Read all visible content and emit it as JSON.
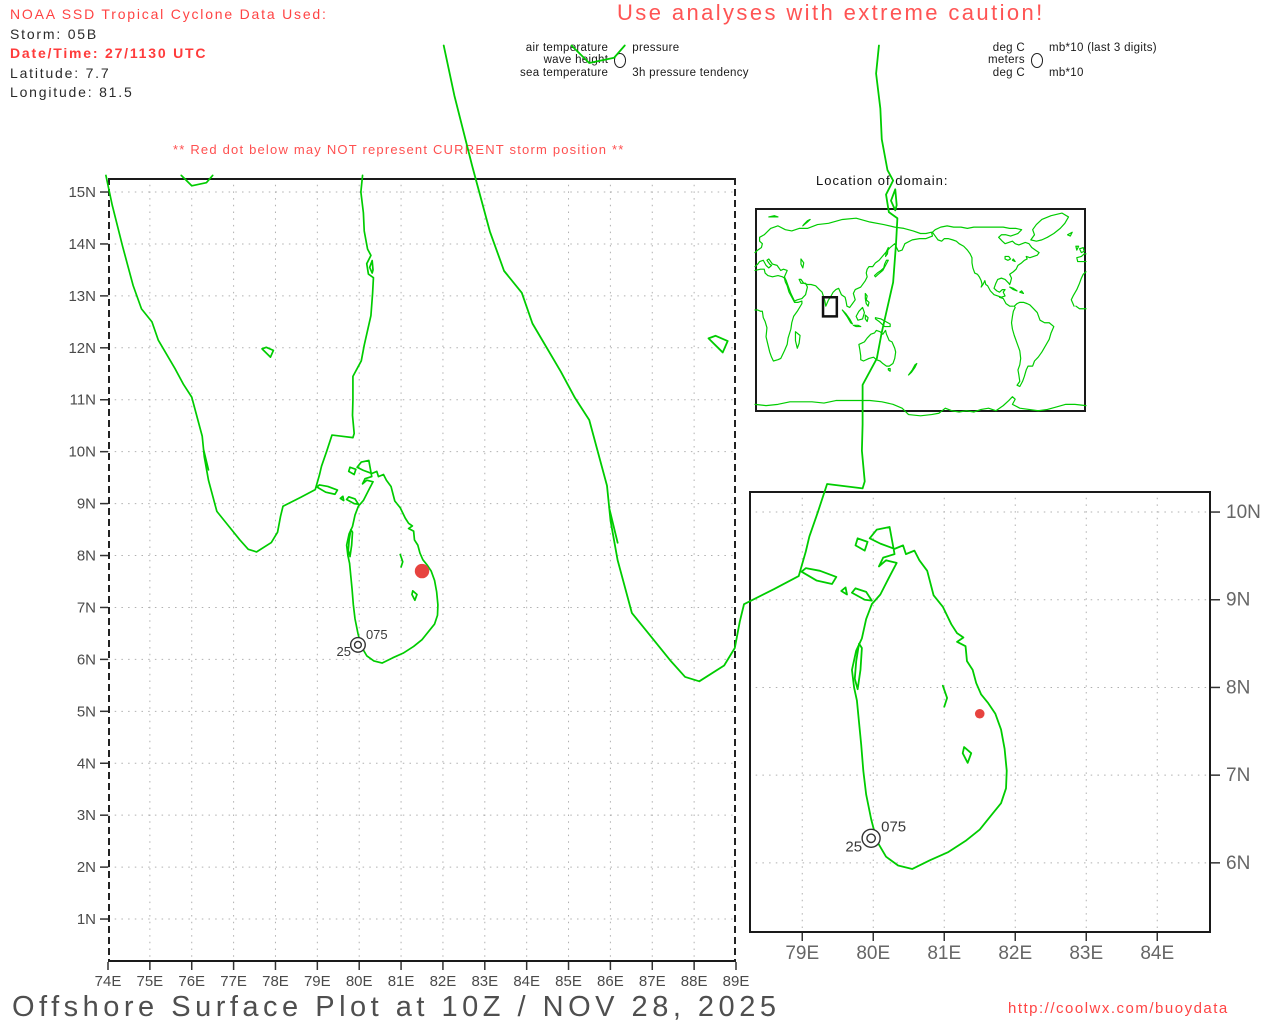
{
  "header": {
    "line1": "NOAA SSD Tropical Cyclone Data Used:",
    "line2": "Storm: 05B",
    "line3": "Date/Time: 27/1130 UTC",
    "line4": "Latitude: 7.7",
    "line5": "Longitude: 81.5"
  },
  "caution_title": "Use analyses with extreme caution!",
  "station_legend": {
    "left_labels": [
      "air temperature",
      "wave height",
      "sea temperature"
    ],
    "right_labels": [
      "pressure",
      "",
      "3h pressure tendency"
    ]
  },
  "units_legend": {
    "left_labels": [
      "deg C",
      "meters",
      "deg C"
    ],
    "right_labels": [
      "mb*10 (last 3 digits)",
      "",
      "mb*10"
    ]
  },
  "storm_warning": "** Red dot below may NOT represent CURRENT storm position **",
  "domain_inset_title": "Location of domain:",
  "footer": {
    "title": "Offshore Surface Plot at 10Z / NOV 28, 2025",
    "url": "http://coolwx.com/buoydata"
  },
  "colors": {
    "coastline": "#00CC00",
    "red_text": "#FF5050",
    "storm_dot": "#E7433F",
    "grid": "#B0B0B0",
    "frame": "#1A1A1A",
    "axis_label_main": "#4A4A4A",
    "axis_label_inset": "#666666"
  },
  "chart_data": [
    {
      "type": "scatter",
      "name": "main-map",
      "title": "Offshore surface observations, southern India / Sri Lanka domain",
      "x_axis_ticks": [
        "74E",
        "75E",
        "76E",
        "77E",
        "78E",
        "79E",
        "80E",
        "81E",
        "82E",
        "83E",
        "84E",
        "85E",
        "86E",
        "87E",
        "88E",
        "89E"
      ],
      "y_axis_ticks": [
        "1N",
        "2N",
        "3N",
        "4N",
        "5N",
        "6N",
        "7N",
        "8N",
        "9N",
        "10N",
        "11N",
        "12N",
        "13N",
        "14N",
        "15N"
      ],
      "lon_range": [
        74,
        89.0
      ],
      "lat_range": [
        0.2,
        15.3
      ],
      "grid": "dotted",
      "points": [
        {
          "name": "storm-position",
          "lon": 81.5,
          "lat": 7.7
        }
      ],
      "station": {
        "lon": 79.97,
        "lat": 6.28,
        "pressure": "075",
        "sea_temperature": "25"
      }
    },
    {
      "type": "scatter",
      "name": "sri-lanka-inset",
      "title": "Sri Lanka zoom",
      "x_axis_ticks": [
        "79E",
        "80E",
        "81E",
        "82E",
        "83E",
        "84E"
      ],
      "y_axis_ticks": [
        "6N",
        "7N",
        "8N",
        "9N",
        "10N"
      ],
      "lon_range": [
        78.25,
        84.76
      ],
      "lat_range": [
        5.2,
        10.24
      ],
      "grid": "dotted",
      "points": [
        {
          "name": "storm-position",
          "lon": 81.5,
          "lat": 7.7
        }
      ],
      "station": {
        "lon": 79.97,
        "lat": 6.28,
        "pressure": "075",
        "sea_temperature": "25"
      }
    },
    {
      "type": "scatter",
      "name": "world-domain-inset",
      "title": "Location of domain",
      "domain_box": {
        "lon_min": 74,
        "lon_max": 89,
        "lat_min": 0,
        "lat_max": 15
      }
    }
  ]
}
